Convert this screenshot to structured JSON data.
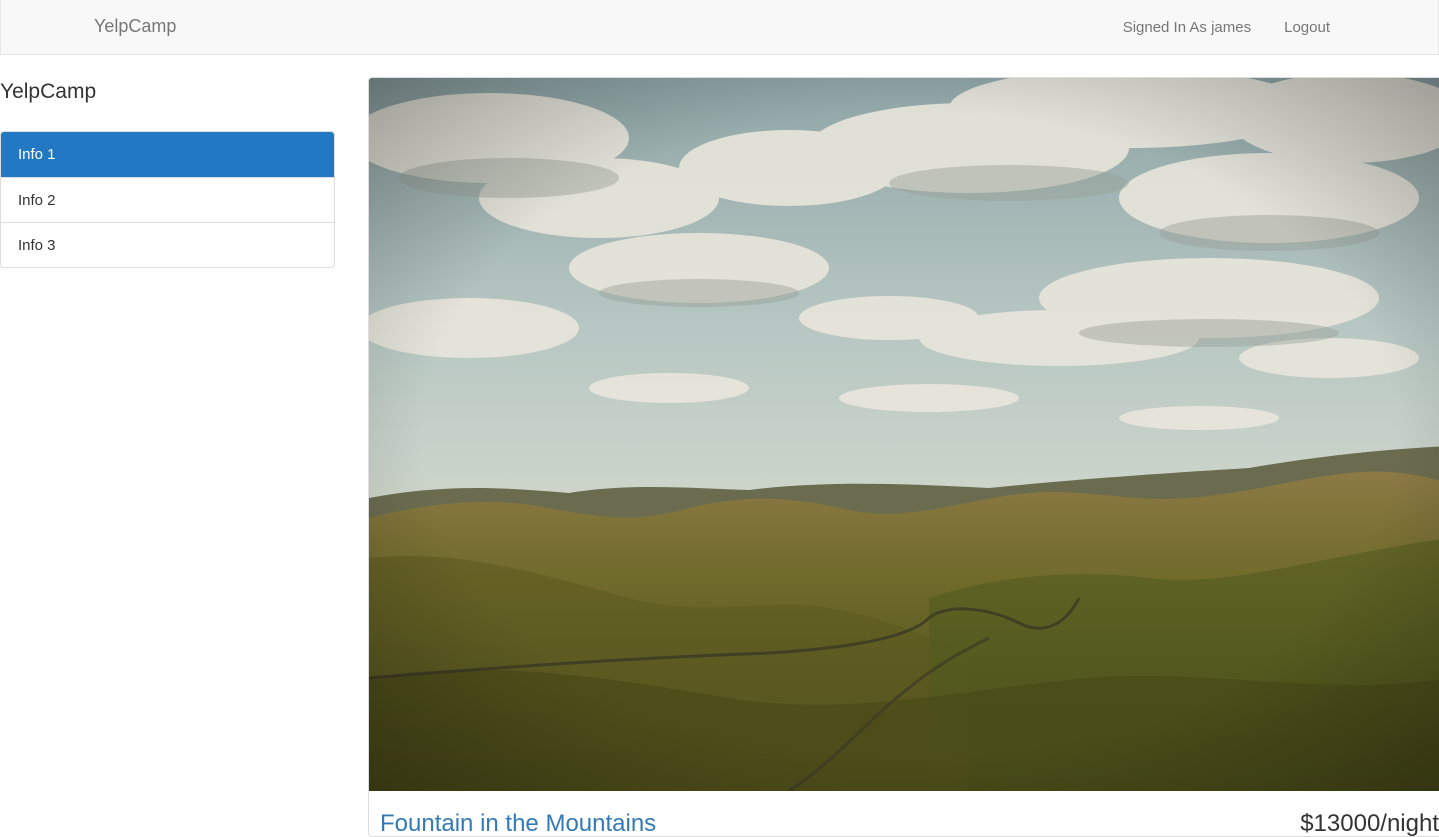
{
  "navbar": {
    "brand": "YelpCamp",
    "signed_in": "Signed In As james",
    "logout": "Logout"
  },
  "sidebar": {
    "title": "YelpCamp",
    "items": [
      {
        "label": "Info 1",
        "active": true
      },
      {
        "label": "Info 2",
        "active": false
      },
      {
        "label": "Info 3",
        "active": false
      }
    ]
  },
  "campground": {
    "name": "Fountain in the Mountains",
    "price": "$13000/night"
  },
  "colors": {
    "accent": "#2378c4",
    "link": "#337ab7",
    "navbar_bg": "#f8f8f8"
  }
}
